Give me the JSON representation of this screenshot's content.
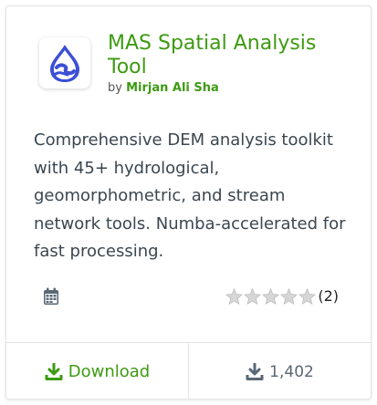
{
  "plugin": {
    "title": "MAS Spatial Analysis Tool",
    "by_label": "by",
    "author": "Mirjan Ali Sha",
    "description": "Comprehensive DEM analysis toolkit with 45+ hydrological, geomorphometric, and stream network tools. Numba-accelerated for fast processing.",
    "logo_icon": "water-drop-river-logo",
    "rating_stars": 0,
    "rating_max": 5,
    "rating_count": "(2)",
    "calendar_icon": "calendar-icon"
  },
  "footer": {
    "download_label": "Download",
    "download_count": "1,402"
  },
  "colors": {
    "accent_green": "#3d9a12",
    "logo_blue": "#3b4fd6",
    "muted_gray": "#5a6775",
    "star_gray": "#cccccc"
  }
}
